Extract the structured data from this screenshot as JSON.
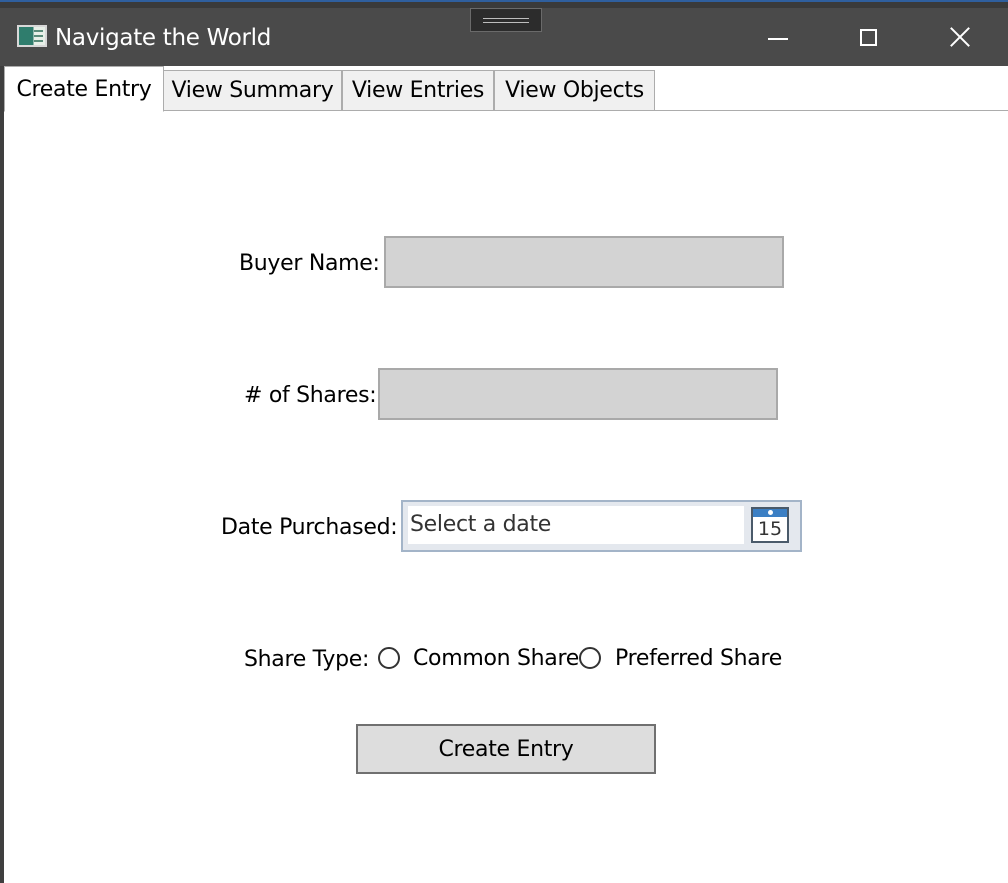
{
  "window": {
    "title": "Navigate the World",
    "icon": "app-window-icon",
    "controls": {
      "minimize_icon": "minimize-icon",
      "maximize_icon": "maximize-icon",
      "close_icon": "close-icon"
    }
  },
  "tabs": [
    {
      "label": "Create Entry",
      "active": true
    },
    {
      "label": "View Summary",
      "active": false
    },
    {
      "label": "View Entries",
      "active": false
    },
    {
      "label": "View Objects",
      "active": false
    }
  ],
  "form": {
    "buyer_name": {
      "label": "Buyer Name:",
      "value": ""
    },
    "shares": {
      "label": "# of Shares:",
      "value": ""
    },
    "date_purchased": {
      "label": "Date Purchased:",
      "placeholder": "Select a date",
      "calendar_icon": "calendar-icon",
      "calendar_day": "15"
    },
    "share_type": {
      "label": "Share Type:",
      "options": [
        {
          "label": "Common Share",
          "selected": false
        },
        {
          "label": "Preferred Share",
          "selected": false
        }
      ]
    },
    "submit_label": "Create Entry"
  },
  "colors": {
    "titlebar": "#4a4a4a",
    "textbox_bg": "#d3d3d3",
    "button_bg": "#dddddd",
    "accent": "#3b7fc4"
  }
}
